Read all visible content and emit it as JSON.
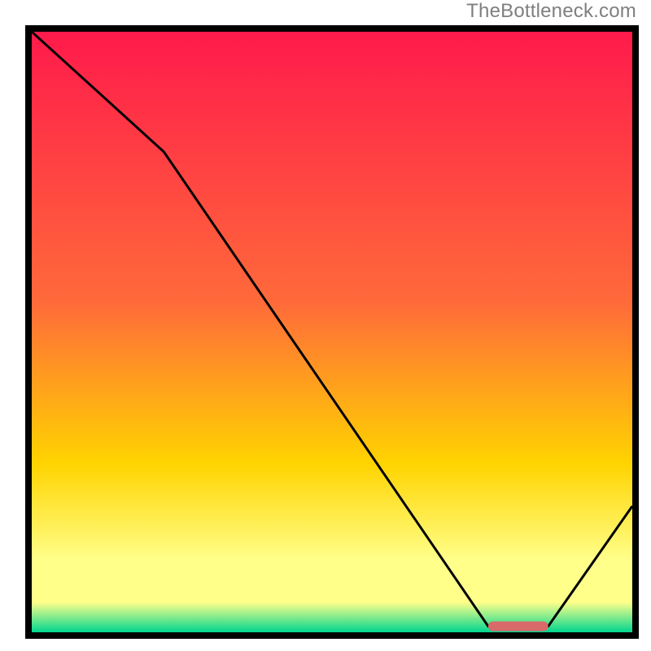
{
  "attribution": "TheBottleneck.com",
  "colors": {
    "heat_top": "#ff1a4b",
    "heat_mid1": "#ff6a3a",
    "heat_mid2": "#ffd400",
    "heat_pale": "#ffff8a",
    "heat_green": "#00d68f",
    "line": "#000000",
    "marker": "#d86a6a"
  },
  "chart_data": {
    "type": "line",
    "title": "",
    "xlabel": "",
    "ylabel": "",
    "xlim": [
      0,
      100
    ],
    "ylim": [
      0,
      100
    ],
    "series": [
      {
        "name": "bottleneck-curve",
        "x": [
          0,
          22,
          76,
          86,
          100
        ],
        "y": [
          100,
          80,
          1,
          1,
          21
        ]
      }
    ],
    "marker": {
      "name": "optimal-range",
      "x_start": 76,
      "x_end": 86,
      "y": 1
    },
    "gradient_stops_pct": [
      0,
      45,
      72,
      88,
      95,
      100
    ]
  }
}
